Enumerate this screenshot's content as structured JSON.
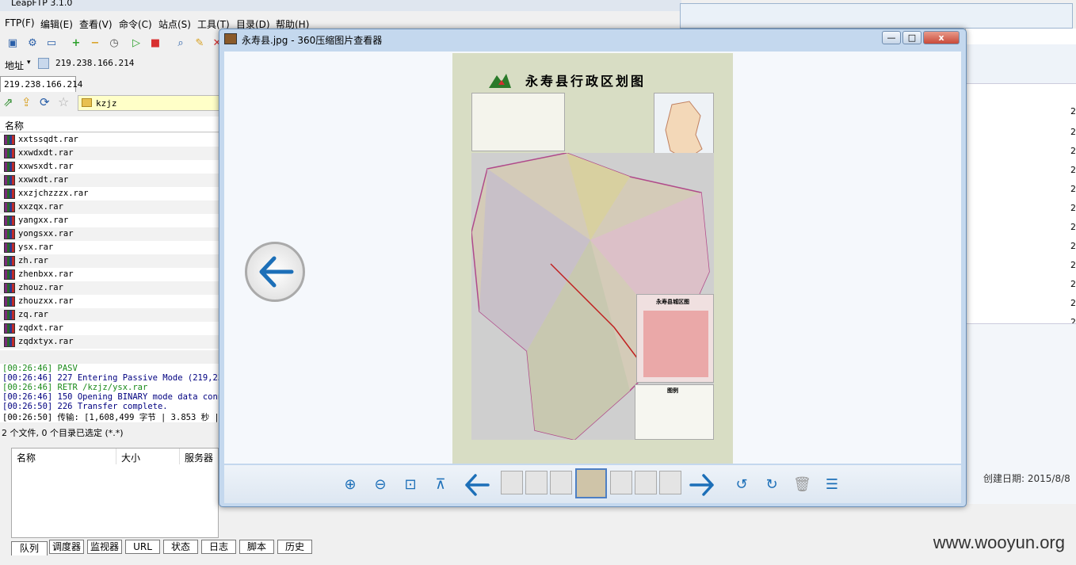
{
  "leapftp": {
    "title": "LeapFTP 3.1.0",
    "menu": [
      "FTP(F)",
      "编辑(E)",
      "查看(V)",
      "命令(C)",
      "站点(S)",
      "工具(T)",
      "目录(D)",
      "帮助(H)"
    ],
    "address_label": "地址",
    "address_value": "219.238.166.214",
    "host_tab": "219.238.166.214",
    "path_value": "kzjz",
    "list_header": "名称",
    "files": [
      "xxtssqdt.rar",
      "xxwdxdt.rar",
      "xxwsxdt.rar",
      "xxwxdt.rar",
      "xxzjchzzzx.rar",
      "xxzqx.rar",
      "yangxx.rar",
      "yongsxx.rar",
      "ysx.rar",
      "zh.rar",
      "zhenbxx.rar",
      "zhouz.rar",
      "zhouzxx.rar",
      "zq.rar",
      "zqdxt.rar",
      "zqdxtyx.rar"
    ],
    "log": [
      "[00:26:46] PASV",
      "[00:26:46] 227 Entering Passive Mode (219,238",
      "[00:26:46] RETR /kzjz/ysx.rar",
      "[00:26:46] 150 Opening BINARY mode data conne",
      "[00:26:50] 226 Transfer complete.",
      "[00:26:50] 传输: [1,608,499 字节 | 3.853 秒 |"
    ],
    "status": "2 个文件, 0 个目录已选定 (*.*)",
    "queue_headers": [
      "名称",
      "大小",
      "服务器"
    ],
    "bottom_tabs": [
      "队列",
      "调度器",
      "监视器",
      "URL",
      "状态",
      "日志",
      "脚本",
      "历史"
    ]
  },
  "right_window": {
    "created_label": "创建日期: 2015/8/8",
    "numbers": [
      "2",
      "2",
      "2",
      "2",
      "2",
      "2",
      "2",
      "2",
      "2",
      "2",
      "2",
      "2"
    ]
  },
  "viewer": {
    "title": "永寿县.jpg - 360压缩图片查看器",
    "window_buttons": {
      "minimize": "—",
      "maximize": "□",
      "close": "x"
    },
    "map_title": "永寿县行政区划图",
    "inset_title": "永寿县城区图",
    "legend_title": "图例"
  },
  "watermark": "www.wooyun.org",
  "colors": {
    "viewer_border": "#6a8fb8",
    "icon_blue": "#1c6fb8",
    "close_red": "#c94a3a"
  }
}
